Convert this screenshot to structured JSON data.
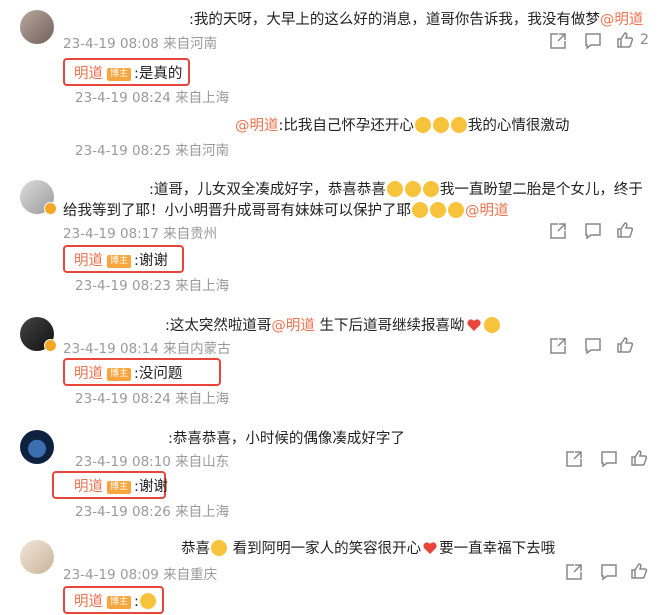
{
  "comments": [
    {
      "text": ":我的天呀，大早上的这么好的消息，道哥你告诉我，我没有做梦",
      "mention": "@明道",
      "time": "23-4-19 08:08 来自河南",
      "likes": "2",
      "replies": [
        {
          "name": "明道",
          "badge": "博主",
          "text": ":是真的",
          "time": "23-4-19 08:24 来自上海"
        },
        {
          "mention": "@明道",
          "text": ":比我自己怀孕还开心",
          "text2": "我的心情很激动",
          "time": "23-4-19 08:25 来自河南"
        }
      ]
    },
    {
      "line1": ":道哥，儿女双全凑成好字，恭喜恭喜",
      "line1b": "我一直盼望二胎是个女儿，终于",
      "line2": "给我等到了耶！小小明晋升成哥哥有妹妹可以保护了耶",
      "mention": "@明道",
      "time": "23-4-19 08:17 来自贵州",
      "reply": {
        "name": "明道",
        "badge": "博主",
        "text": ":谢谢",
        "time": "23-4-19 08:23 来自上海"
      }
    },
    {
      "text": ":这太突然啦道哥",
      "mention": "@明道",
      "text2": " 生下后道哥继续报喜呦",
      "time": "23-4-19 08:14 来自内蒙古",
      "reply": {
        "name": "明道",
        "badge": "博主",
        "text": ":没问题",
        "time": "23-4-19 08:24 来自上海"
      }
    },
    {
      "text": ":恭喜恭喜，小时候的偶像凑成好字了",
      "time": "23-4-19 08:10 来自山东",
      "reply": {
        "name": "明道",
        "badge": "博主",
        "text": ":谢谢",
        "time": "23-4-19 08:26 来自上海"
      }
    },
    {
      "text": "恭喜",
      "text2": " 看到阿明一家人的笑容很开心",
      "text3": "要一直幸福下去哦",
      "time": "23-4-19 08:09 来自重庆",
      "reply": {
        "name": "明道",
        "badge": "博主",
        "text": ":"
      }
    }
  ],
  "icons": {
    "share": "share-icon",
    "comment": "comment-icon",
    "like": "thumbs-up-icon"
  },
  "colors": {
    "accent": "#eb7350",
    "highlight": "#e8453c",
    "badge": "#f9a53d"
  }
}
